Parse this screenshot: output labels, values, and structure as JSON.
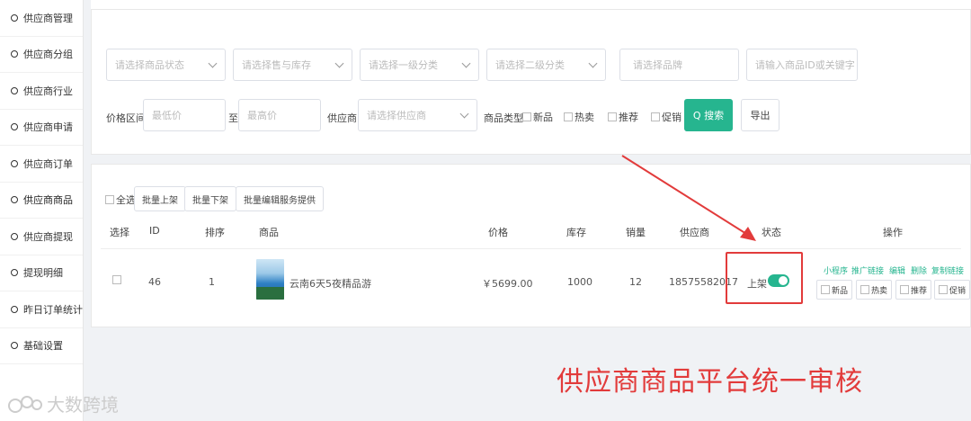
{
  "sidebar": {
    "items": [
      {
        "label": "供应商管理"
      },
      {
        "label": "供应商分组"
      },
      {
        "label": "供应商行业"
      },
      {
        "label": "供应商申请"
      },
      {
        "label": "供应商订单"
      },
      {
        "label": "供应商商品"
      },
      {
        "label": "供应商提现"
      },
      {
        "label": "提现明细"
      },
      {
        "label": "昨日订单统计"
      },
      {
        "label": "基础设置"
      }
    ]
  },
  "filters": {
    "approval_status_placeholder": "请选择商品状态",
    "stock_placeholder": "请选择售与库存",
    "category1_placeholder": "请选择一级分类",
    "category2_placeholder": "请选择二级分类",
    "brand_placeholder": "请选择品牌",
    "keyword_placeholder": "请输入商品ID或关键字",
    "price_range_label": "价格区间",
    "min_price_placeholder": "最低价",
    "to_label": "至",
    "max_price_placeholder": "最高价",
    "supplier_label": "供应商",
    "supplier_placeholder": "请选择供应商",
    "type_label": "商品类型",
    "type_new": "新品",
    "type_hot": "热卖",
    "type_recommend": "推荐",
    "type_promo": "促销",
    "search_button": "Q 搜索",
    "export_button": "导出"
  },
  "bulk": {
    "select_all": "全选",
    "batch_up": "批量上架",
    "batch_down": "批量下架",
    "batch_service": "批量编辑服务提供"
  },
  "table": {
    "headers": {
      "select": "选择",
      "id": "ID",
      "sort": "排序",
      "product": "商品",
      "price": "价格",
      "stock": "库存",
      "sales": "销量",
      "supplier": "供应商",
      "status": "状态",
      "actions": "操作"
    },
    "rows": [
      {
        "id": "46",
        "sort": "1",
        "product_name": "云南6天5夜精品游",
        "price": "￥5699.00",
        "stock": "1000",
        "sales": "12",
        "supplier": "18575582017",
        "status_label": "上架",
        "status_on": true,
        "links": {
          "mini": "小程序",
          "promo_link": "推广链接",
          "edit": "编辑",
          "delete": "删除",
          "copy_link": "复制链接"
        },
        "tags": {
          "new": "新品",
          "hot": "热卖",
          "recommend": "推荐",
          "promo": "促销"
        }
      }
    ]
  },
  "annotation": {
    "text": "供应商商品平台统一审核",
    "color": "#e23b3b"
  },
  "watermark": {
    "text": "大数跨境"
  },
  "colors": {
    "accent": "#26b58f",
    "highlight": "#e23b3b"
  }
}
